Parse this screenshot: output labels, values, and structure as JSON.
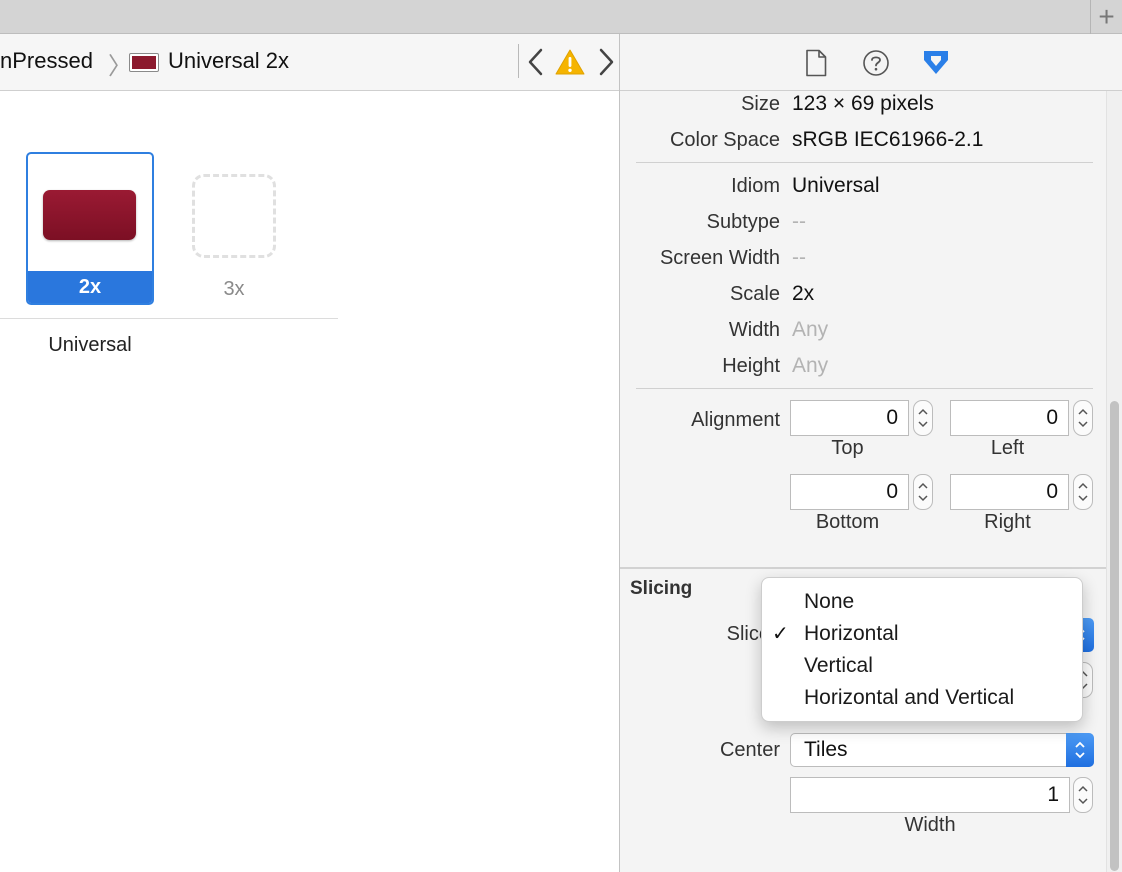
{
  "top_bar": {
    "add_tab_glyph": "+"
  },
  "jump_bar": {
    "crumb_image_set": "nPressed",
    "crumb_separator": "〉",
    "crumb_slot": "Universal 2x",
    "swatch_color": "#8c1a2e",
    "warning_color": "#f5b400"
  },
  "asset_slots": {
    "selected_scale": "2x",
    "empty_scale": "3x",
    "idiom": "Universal",
    "selection_color": "#2a77dd"
  },
  "inspector": {
    "tab_icons": [
      "file-icon",
      "help-icon",
      "attributes-icon"
    ],
    "active_tab_color": "#2a7fe8",
    "image": {
      "size_label": "Size",
      "size_value": "123 × 69 pixels",
      "colorspace_label": "Color Space",
      "colorspace_value": "sRGB IEC61966-2.1",
      "idiom_label": "Idiom",
      "idiom_value": "Universal",
      "subtype_label": "Subtype",
      "subtype_value": "--",
      "screen_width_label": "Screen Width",
      "screen_width_value": "--",
      "scale_label": "Scale",
      "scale_value": "2x",
      "width_label": "Width",
      "width_value": "Any",
      "height_label": "Height",
      "height_value": "Any"
    },
    "alignment": {
      "label": "Alignment",
      "top_value": "0",
      "top_caption": "Top",
      "left_value": "0",
      "left_caption": "Left",
      "bottom_value": "0",
      "bottom_caption": "Bottom",
      "right_value": "0",
      "right_caption": "Right"
    },
    "slicing": {
      "title": "Slicing",
      "slices_label": "Slices",
      "slices_menu": {
        "options": [
          "None",
          "Horizontal",
          "Vertical",
          "Horizontal and Vertical"
        ],
        "selected": "Horizontal",
        "check_glyph": "✓"
      },
      "center_label": "Center",
      "center_value": "Tiles",
      "center_width_value": "1",
      "center_width_caption": "Width"
    }
  }
}
